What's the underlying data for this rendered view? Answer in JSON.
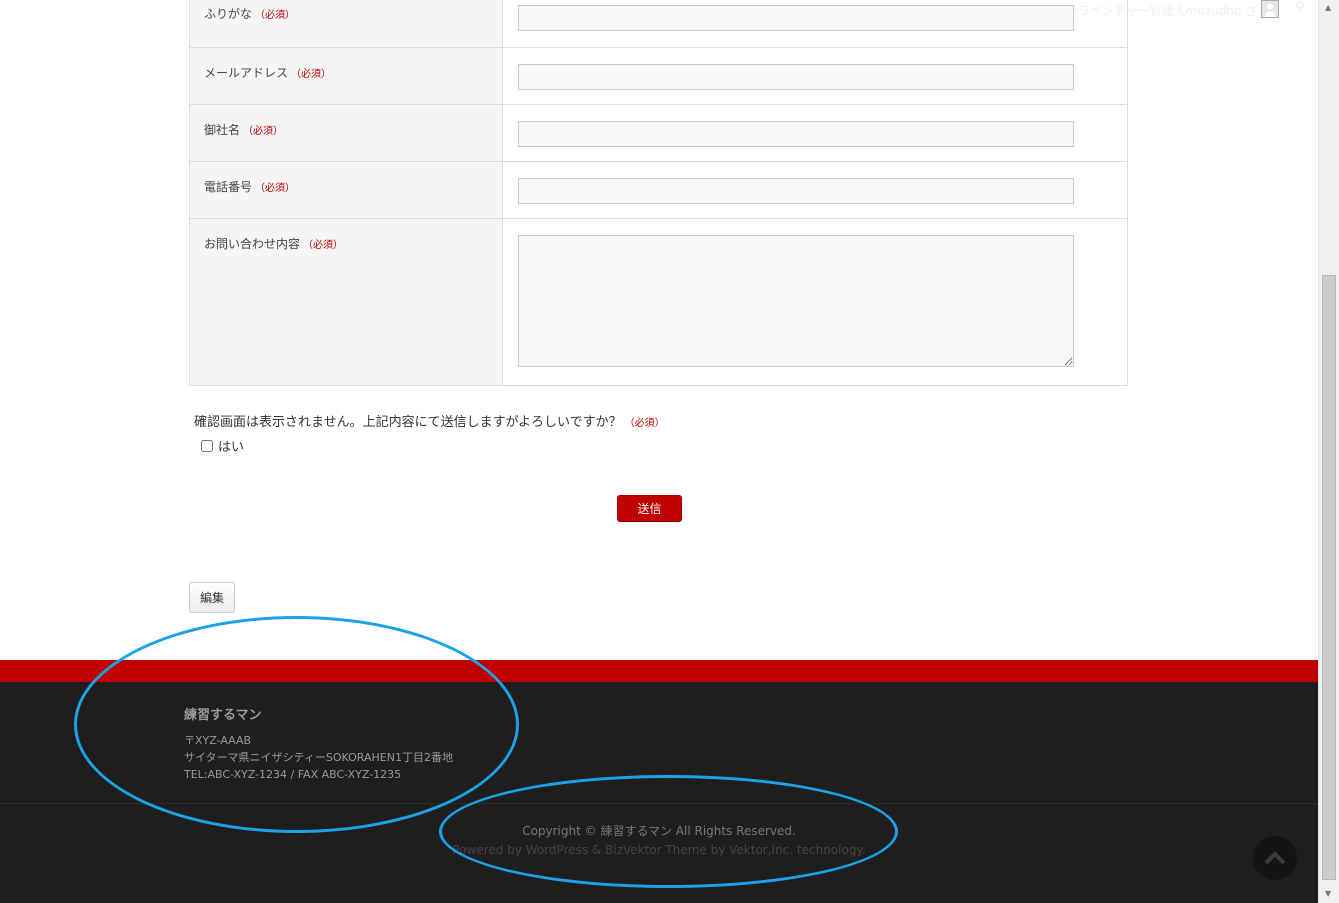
{
  "header": {
    "greeting": "こんにちは、ララベンチャー管理人muzudho さん！",
    "avatar_icon": "user-avatar-icon",
    "search_icon": "search-icon"
  },
  "form": {
    "required_mark": "（必須）",
    "rows": [
      {
        "label": "ふりがな",
        "type": "text",
        "value": ""
      },
      {
        "label": "メールアドレス",
        "type": "text",
        "value": ""
      },
      {
        "label": "御社名",
        "type": "text",
        "value": ""
      },
      {
        "label": "電話番号",
        "type": "text",
        "value": ""
      },
      {
        "label": "お問い合わせ内容",
        "type": "textarea",
        "value": ""
      }
    ],
    "confirm_question": "確認画面は表示されません。上記内容にて送信しますがよろしいですか？",
    "confirm_option": "はい",
    "confirm_checked": false,
    "submit_label": "送信",
    "edit_label": "編集"
  },
  "footer": {
    "site_name": "練習するマン",
    "postal": "〒XYZ-AAAB",
    "address": "サイターマ県ニイザシティーSOKORAHEN1丁目2番地",
    "tel_fax": "TEL:ABC-XYZ-1234 / FAX ABC-XYZ-1235",
    "copyright": "Copyright © 練習するマン All Rights Reserved.",
    "powered": "Powered by WordPress & BizVektor Theme by Vektor,Inc. technology.",
    "to_top_icon": "chevron-up-icon"
  },
  "colors": {
    "accent_red": "#c00000",
    "footer_bg": "#1e1e1e",
    "annotation_blue": "#1aa3e8"
  }
}
